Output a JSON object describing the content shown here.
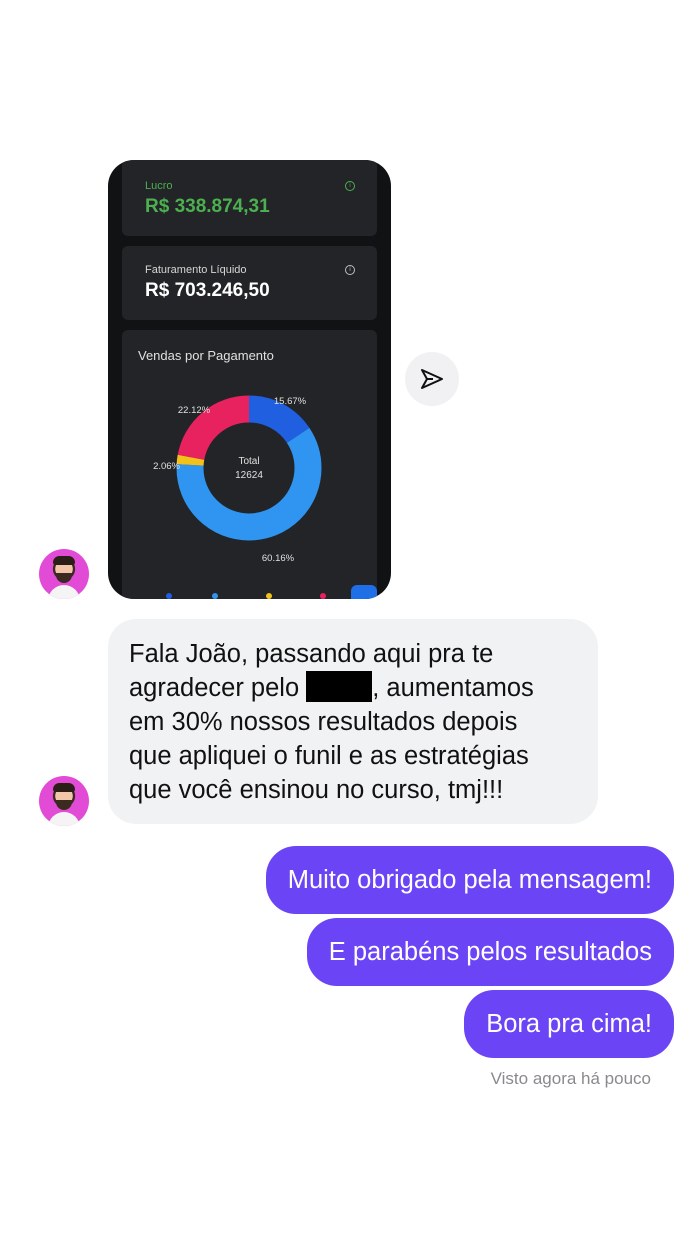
{
  "screenshot": {
    "lucro_label": "Lucro",
    "lucro_value": "R$ 338.874,31",
    "faturamento_label": "Faturamento Líquido",
    "faturamento_value": "R$ 703.246,50",
    "vendas_title": "Vendas por Pagamento",
    "donut_center_label": "Total",
    "donut_center_value": "12624",
    "chart_data": {
      "type": "pie",
      "title": "Vendas por Pagamento",
      "slices": [
        {
          "label": "15.67%",
          "value": 15.67,
          "color": "#1f5fe0"
        },
        {
          "label": "60.16%",
          "value": 60.16,
          "color": "#2f95f0"
        },
        {
          "label": "2.06%",
          "value": 2.06,
          "color": "#f2c21b"
        },
        {
          "label": "22.12%",
          "value": 22.12,
          "color": "#e8225f"
        }
      ],
      "total_label": "Total",
      "total_value": 12624
    },
    "legend_dot_colors": [
      "#1f5fe0",
      "#2f95f0",
      "#f2c21b",
      "#e8225f"
    ]
  },
  "incoming_message": {
    "line1": "Fala João, passando aqui pra te",
    "line2_start": "agradecer pelo ",
    "line2_end": ", aumentamos",
    "line3": "em 30% nossos resultados depois",
    "line4": "que apliquei o funil e as estratégias",
    "line5": "que você ensinou no curso, tmj!!!"
  },
  "outgoing_messages": [
    "Muito obrigado pela mensagem!",
    "E parabéns pelos resultados",
    "Bora pra cima!"
  ],
  "status": "Visto agora há pouco",
  "colors": {
    "outgoing_bubble": "#6b45f5",
    "incoming_bubble": "#f1f2f4",
    "lucro_green": "#4caf50"
  },
  "icons": {
    "send": "send-icon",
    "info": "info-icon"
  }
}
